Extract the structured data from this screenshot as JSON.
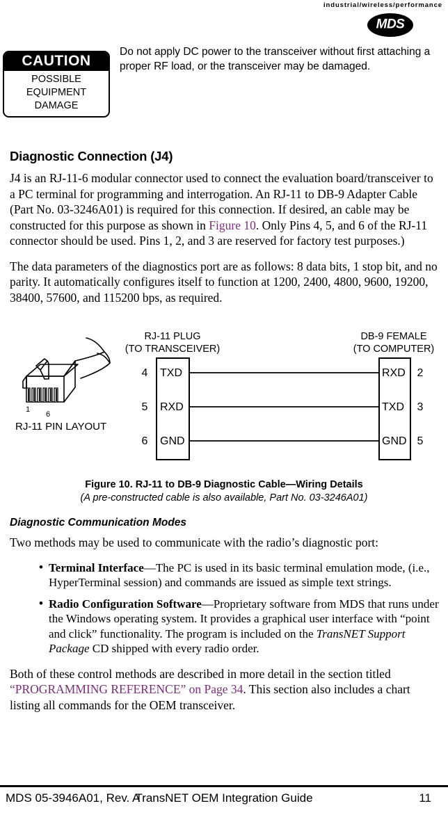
{
  "header": {
    "tagline": "industrial/wireless/performance",
    "logo_text": "MDS"
  },
  "caution": {
    "title": "CAUTION",
    "line1": "POSSIBLE",
    "line2": "EQUIPMENT",
    "line3": "DAMAGE",
    "message": "Do not apply DC power to the transceiver without first attaching a proper RF load, or the transceiver may be damaged."
  },
  "section": {
    "heading": "Diagnostic Connection (J4)",
    "para1_a": "J4 is an RJ-11-6 modular connector used to connect the evaluation board/transceiver to a PC terminal for programming and interrogation. An RJ-11 to DB-9 Adapter Cable (Part No. 03-3246A01) is required for this connection. If desired, an cable may be constructed for this purpose as shown in ",
    "para1_link": "Figure 10",
    "para1_b": ". Only Pins 4, 5, and 6 of the RJ-11 connector should be used. Pins 1, 2, and 3 are reserved for factory test purposes.)",
    "para2": "The data parameters of the diagnostics port are as follows: 8 data bits, 1 stop bit, and no parity. It automatically configures itself to function at 1200, 2400, 4800, 9600, 19200, 38400, 57600, and 115200 bps, as required."
  },
  "figure": {
    "left_title_line1": "RJ-11 PLUG",
    "left_title_line2": "(TO TRANSCEIVER)",
    "right_title_line1": "DB-9 FEMALE",
    "right_title_line2": "(TO COMPUTER)",
    "pin_layout_label": "RJ-11 PIN LAYOUT",
    "connector_pin_first": "1",
    "connector_pin_last": "6",
    "rows": [
      {
        "left_pin": "4",
        "left_signal": "TXD",
        "right_signal": "RXD",
        "right_pin": "2"
      },
      {
        "left_pin": "5",
        "left_signal": "RXD",
        "right_signal": "TXD",
        "right_pin": "3"
      },
      {
        "left_pin": "6",
        "left_signal": "GND",
        "right_signal": "GND",
        "right_pin": "5"
      }
    ],
    "caption_line1": "Figure 10. RJ-11 to DB-9 Diagnostic Cable—Wiring Details",
    "caption_line2": "(A pre-constructed cable is also available, Part No. 03-3246A01)"
  },
  "modes": {
    "heading": "Diagnostic Communication Modes",
    "intro": "Two methods may be used to communicate with the radio’s diagnostic port:",
    "bullet_marker": "•",
    "items": [
      {
        "term": "Terminal Interface",
        "desc": "—The PC is used in its basic terminal emulation mode, (i.e., HyperTerminal session) and commands are issued as simple text strings."
      },
      {
        "term": "Radio Configuration Software",
        "desc_a": "—Proprietary software from MDS that runs under the Windows operating system. It provides a graphical user interface with “point and click” functionality. The program is included on the ",
        "desc_italic": "TransNET Support Package",
        "desc_b": " CD shipped with every radio order."
      }
    ],
    "closing_a": "Both of these control methods are described in more detail in the section titled ",
    "closing_link": "“PROGRAMMING REFERENCE” on Page 34",
    "closing_b": ". This section also includes a chart listing all commands for the OEM transceiver."
  },
  "footer": {
    "left": "MDS 05-3946A01, Rev.  A",
    "center": "TransNET OEM Integration Guide",
    "page": "11"
  },
  "colors": {
    "link": "#7B2D7B",
    "ink": "#000000",
    "paper": "#FFFFFF"
  }
}
